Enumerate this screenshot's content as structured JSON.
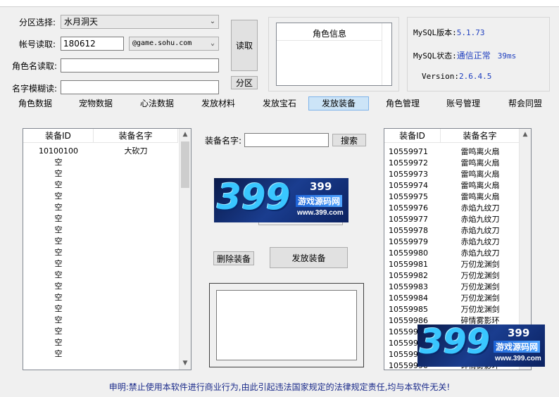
{
  "window": {
    "title": ""
  },
  "form": {
    "zone_label": "分区选择:",
    "zone_value": "水月洞天",
    "account_label": "帐号读取:",
    "account_value": "180612",
    "domain_value": "@game.sohu.com",
    "rolename_label": "角色名读取:",
    "rolename_value": "",
    "fuzzy_label": "名字模糊读:",
    "fuzzy_value": "",
    "read_button": "读取",
    "zone_button": "分区"
  },
  "role_info": {
    "title": "角色信息"
  },
  "status": {
    "mysql_version_label": "MySQL版本:",
    "mysql_version_value": "5.1.73",
    "mysql_status_label": "MySQL状态:",
    "mysql_status_value": "通信正常",
    "mysql_latency": "39ms",
    "version_label": "Version:",
    "version_value": "2.6.4.5"
  },
  "tabs": [
    {
      "label": "角色数据",
      "active": false
    },
    {
      "label": "宠物数据",
      "active": false
    },
    {
      "label": "心法数据",
      "active": false
    },
    {
      "label": "发放材料",
      "active": false
    },
    {
      "label": "发放宝石",
      "active": false
    },
    {
      "label": "发放装备",
      "active": true
    },
    {
      "label": "角色管理",
      "active": false
    },
    {
      "label": "账号管理",
      "active": false
    },
    {
      "label": "帮会同盟",
      "active": false
    }
  ],
  "left_list": {
    "col_id": "装备ID",
    "col_name": "装备名字",
    "rows": [
      {
        "id": "10100100",
        "name": "大砍刀"
      },
      {
        "id": "空",
        "name": ""
      },
      {
        "id": "空",
        "name": ""
      },
      {
        "id": "空",
        "name": ""
      },
      {
        "id": "空",
        "name": ""
      },
      {
        "id": "空",
        "name": ""
      },
      {
        "id": "空",
        "name": ""
      },
      {
        "id": "空",
        "name": ""
      },
      {
        "id": "空",
        "name": ""
      },
      {
        "id": "空",
        "name": ""
      },
      {
        "id": "空",
        "name": ""
      },
      {
        "id": "空",
        "name": ""
      },
      {
        "id": "空",
        "name": ""
      },
      {
        "id": "空",
        "name": ""
      },
      {
        "id": "空",
        "name": ""
      },
      {
        "id": "空",
        "name": ""
      },
      {
        "id": "空",
        "name": ""
      },
      {
        "id": "空",
        "name": ""
      },
      {
        "id": "空",
        "name": ""
      }
    ]
  },
  "middle": {
    "search_label": "装备名字:",
    "search_value": "",
    "search_button": "搜索",
    "delete_button": "删除装备",
    "issue_button": "发放装备"
  },
  "right_list": {
    "col_id": "装备ID",
    "col_name": "装备名字",
    "rows": [
      {
        "id": "10559971",
        "name": "雷鸣离火扇"
      },
      {
        "id": "10559972",
        "name": "雷鸣离火扇"
      },
      {
        "id": "10559973",
        "name": "雷鸣离火扇"
      },
      {
        "id": "10559974",
        "name": "雷鸣离火扇"
      },
      {
        "id": "10559975",
        "name": "雷鸣离火扇"
      },
      {
        "id": "10559976",
        "name": "赤焰九纹刀"
      },
      {
        "id": "10559977",
        "name": "赤焰九纹刀"
      },
      {
        "id": "10559978",
        "name": "赤焰九纹刀"
      },
      {
        "id": "10559979",
        "name": "赤焰九纹刀"
      },
      {
        "id": "10559980",
        "name": "赤焰九纹刀"
      },
      {
        "id": "10559981",
        "name": "万仞龙渊剑"
      },
      {
        "id": "10559982",
        "name": "万仞龙渊剑"
      },
      {
        "id": "10559983",
        "name": "万仞龙渊剑"
      },
      {
        "id": "10559984",
        "name": "万仞龙渊剑"
      },
      {
        "id": "10559985",
        "name": "万仞龙渊剑"
      },
      {
        "id": "10559986",
        "name": "碎情雾影环"
      },
      {
        "id": "1055998",
        "name": ""
      },
      {
        "id": "1055998",
        "name": ""
      },
      {
        "id": "1055998",
        "name": ""
      },
      {
        "id": "10559990",
        "name": "碎情雾影环"
      }
    ]
  },
  "watermark": {
    "number": "399",
    "logo_digits": "399",
    "cn": "游戏源码网",
    "url": "www.399.com"
  },
  "footer": {
    "notice": "申明:禁止使用本软件进行商业行为,由此引起违法国家规定的法律规定责任,均与本软件无关!"
  }
}
